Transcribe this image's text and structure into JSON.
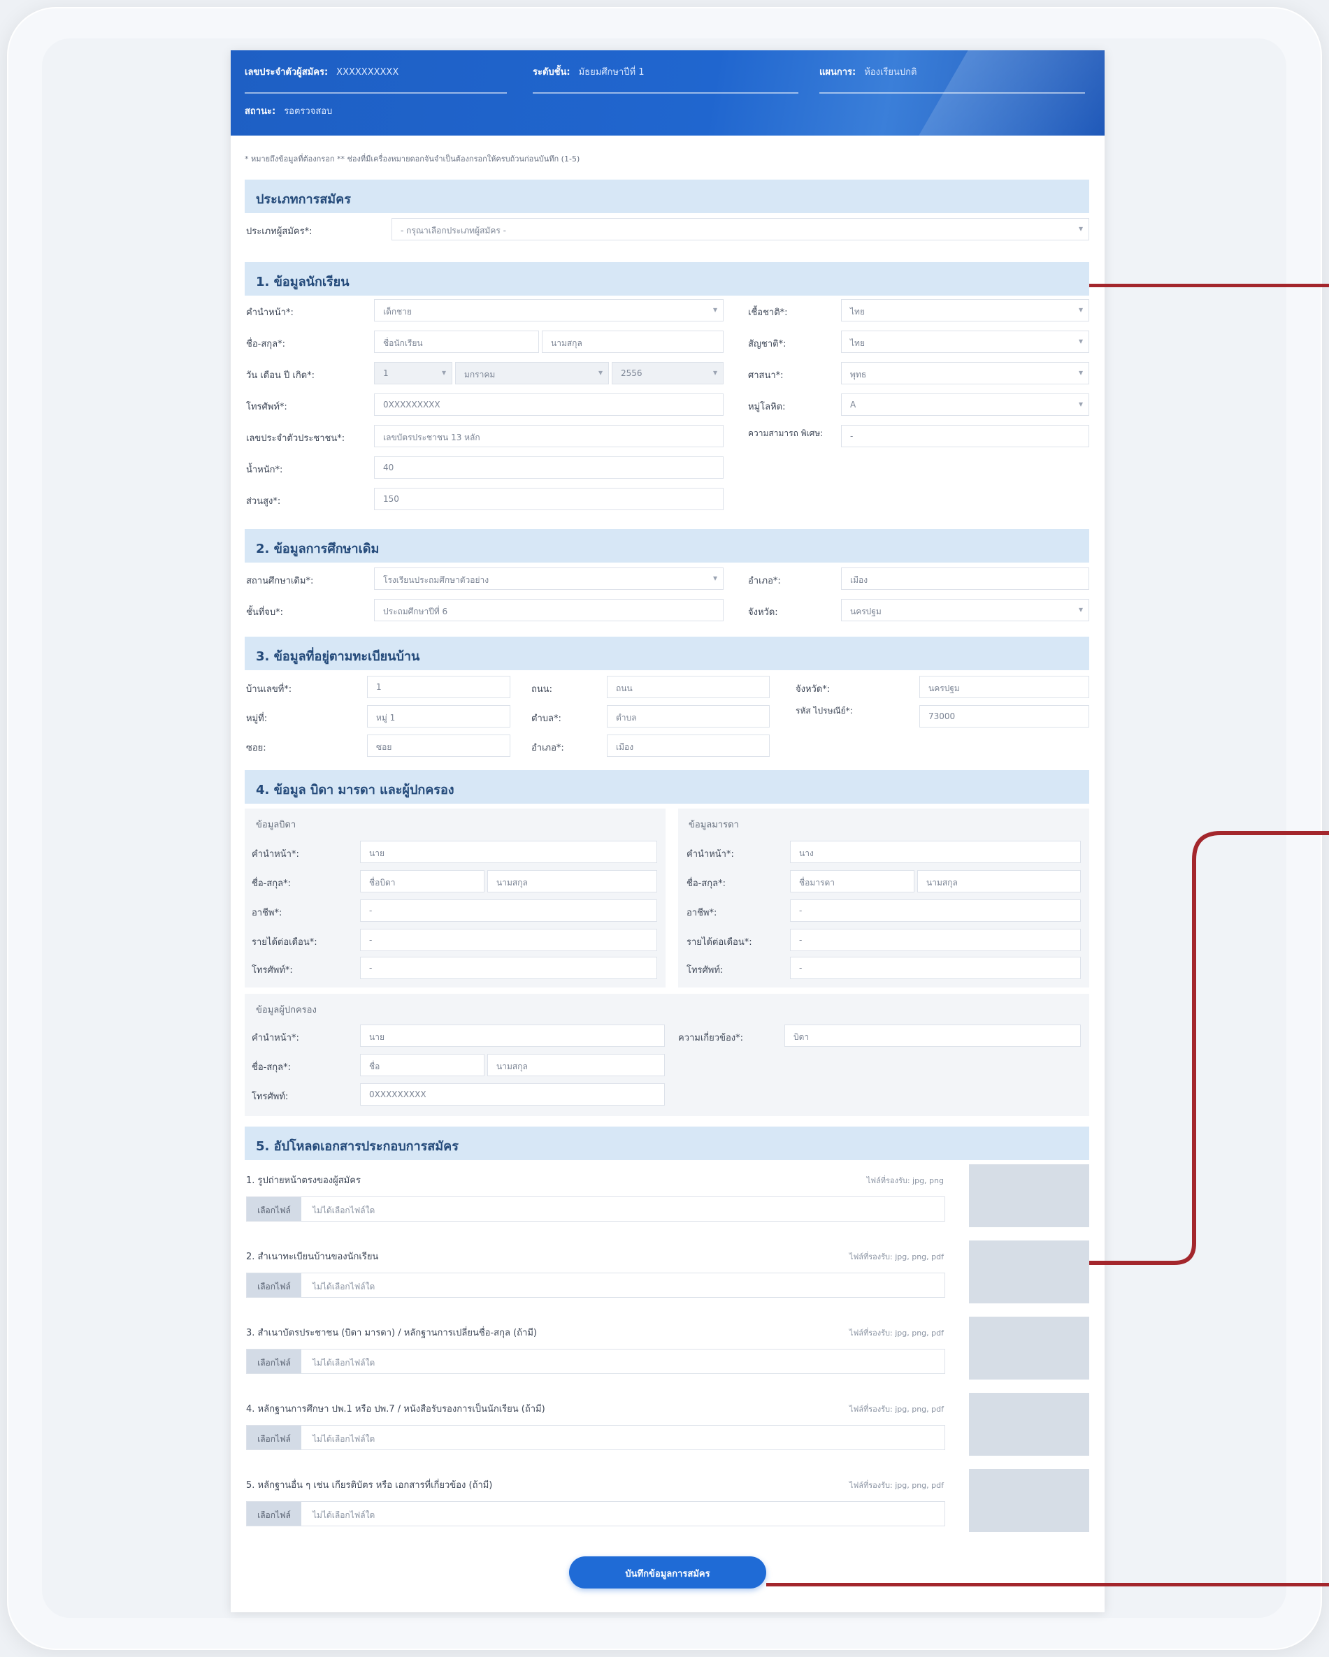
{
  "header": {
    "app_no_label": "เลขประจำตัวผู้สมัคร:",
    "app_no_value": "XXXXXXXXXX",
    "level_label": "ระดับชั้น:",
    "level_value": "มัธยมศึกษาปีที่ 1",
    "program_label": "แผนการ:",
    "program_value": "ห้องเรียนปกติ",
    "status_label": "สถานะ:",
    "status_value": "รอตรวจสอบ"
  },
  "note": "* หมายถึงข้อมูลที่ต้องกรอก  ** ช่องที่มีเครื่องหมายดอกจันจำเป็นต้องกรอกให้ครบถ้วนก่อนบันทึก (1-5)",
  "sec0": {
    "title": "ประเภทการสมัคร",
    "field_label": "ประเภทผู้สมัคร*:",
    "field_value": "- กรุณาเลือกประเภทผู้สมัคร -"
  },
  "sec1": {
    "title": "1. ข้อมูลนักเรียน",
    "left": [
      {
        "label": "คำนำหน้า*:",
        "value": "เด็กชาย",
        "select": true
      },
      {
        "label": "ชื่อ-สกุล*:",
        "value": "ชื่อนักเรียน",
        "value2": "นามสกุล"
      },
      {
        "label": "วัน เดือน ปี เกิด*:",
        "value": "1",
        "value2": "มกราคม",
        "value3": "2556"
      },
      {
        "label": "โทรศัพท์*:",
        "value": "0XXXXXXXXX"
      },
      {
        "label": "เลขประจำตัวประชาชน*:",
        "value": "เลขบัตรประชาชน 13 หลัก"
      },
      {
        "label": "น้ำหนัก*:",
        "value": "40"
      },
      {
        "label": "ส่วนสูง*:",
        "value": "150"
      }
    ],
    "right": [
      {
        "label": "เชื้อชาติ*:",
        "value": "ไทย",
        "select": true
      },
      {
        "label": "สัญชาติ*:",
        "value": "ไทย",
        "select": true
      },
      {
        "label": "ศาสนา*:",
        "value": "พุทธ",
        "select": true
      },
      {
        "label": "หมู่โลหิต:",
        "value": "A",
        "select": true
      },
      {
        "label": "ความสามารถ พิเศษ:",
        "value": "-"
      }
    ]
  },
  "sec2": {
    "title": "2. ข้อมูลการศึกษาเดิม",
    "left": [
      {
        "label": "สถานศึกษาเดิม*:",
        "value": "โรงเรียนประถมศึกษาตัวอย่าง",
        "select": true
      },
      {
        "label": "ชั้นที่จบ*:",
        "value": "ประถมศึกษาปีที่ 6"
      }
    ],
    "right": [
      {
        "label": "อำเภอ*:",
        "value": "เมือง"
      },
      {
        "label": "จังหวัด:",
        "value": "นครปฐม",
        "select": true
      }
    ]
  },
  "sec3": {
    "title": "3. ข้อมูลที่อยู่ตามทะเบียนบ้าน",
    "cells": [
      {
        "label": "บ้านเลขที่*:",
        "value": "1"
      },
      {
        "label": "ถนน:",
        "value": "ถนน"
      },
      {
        "label": "จังหวัด*:",
        "value": "นครปฐม"
      },
      {
        "label": "หมู่ที่:",
        "value": "หมู่ 1"
      },
      {
        "label": "ตำบล*:",
        "value": "ตำบล"
      },
      {
        "label": "รหัส ไปรษณีย์*:",
        "value": "73000"
      },
      {
        "label": "ซอย:",
        "value": "ซอย"
      },
      {
        "label": "อำเภอ*:",
        "value": "เมือง"
      }
    ]
  },
  "sec4": {
    "title": "4. ข้อมูล บิดา มารดา และผู้ปกครอง",
    "father": {
      "title": "ข้อมูลบิดา",
      "rows": [
        {
          "label": "คำนำหน้า*:",
          "value": "นาย"
        },
        {
          "label": "ชื่อ-สกุล*:",
          "value": "ชื่อบิดา",
          "value2": "นามสกุล"
        },
        {
          "label": "อาชีพ*:",
          "value": "-"
        },
        {
          "label": "รายได้ต่อเดือน*:",
          "value": "-"
        },
        {
          "label": "โทรศัพท์*:",
          "value": "-"
        }
      ]
    },
    "mother": {
      "title": "ข้อมูลมารดา",
      "rows": [
        {
          "label": "คำนำหน้า*:",
          "value": "นาง"
        },
        {
          "label": "ชื่อ-สกุล*:",
          "value": "ชื่อมารดา",
          "value2": "นามสกุล"
        },
        {
          "label": "อาชีพ*:",
          "value": "-"
        },
        {
          "label": "รายได้ต่อเดือน*:",
          "value": "-"
        },
        {
          "label": "โทรศัพท์:",
          "value": "-"
        }
      ]
    },
    "guardian": {
      "title": "ข้อมูลผู้ปกครอง",
      "rows": [
        {
          "label": "คำนำหน้า*:",
          "value": "นาย"
        },
        {
          "label": "ชื่อ-สกุล*:",
          "value": "ชื่อ",
          "value2": "นามสกุล"
        },
        {
          "label": "โทรศัพท์:",
          "value": "0XXXXXXXXX"
        }
      ],
      "relation_label": "ความเกี่ยวข้อง*:",
      "relation_value": "บิดา"
    }
  },
  "sec5": {
    "title": "5. อัปโหลดเอกสารประกอบการสมัคร",
    "uploads": [
      {
        "label": "1. รูปถ่ายหน้าตรงของผู้สมัคร",
        "hint": "ไฟล์ที่รองรับ: jpg, png",
        "button": "เลือกไฟล์",
        "file": "ไม่ได้เลือกไฟล์ใด"
      },
      {
        "label": "2. สำเนาทะเบียนบ้านของนักเรียน",
        "hint": "ไฟล์ที่รองรับ: jpg, png, pdf",
        "button": "เลือกไฟล์",
        "file": "ไม่ได้เลือกไฟล์ใด"
      },
      {
        "label": "3. สำเนาบัตรประชาชน (บิดา มารดา) / หลักฐานการเปลี่ยนชื่อ-สกุล (ถ้ามี)",
        "hint": "ไฟล์ที่รองรับ: jpg, png, pdf",
        "button": "เลือกไฟล์",
        "file": "ไม่ได้เลือกไฟล์ใด"
      },
      {
        "label": "4. หลักฐานการศึกษา ปพ.1 หรือ ปพ.7 / หนังสือรับรองการเป็นนักเรียน (ถ้ามี)",
        "hint": "ไฟล์ที่รองรับ: jpg, png, pdf",
        "button": "เลือกไฟล์",
        "file": "ไม่ได้เลือกไฟล์ใด"
      },
      {
        "label": "5. หลักฐานอื่น ๆ เช่น เกียรติบัตร หรือ เอกสารที่เกี่ยวข้อง (ถ้ามี)",
        "hint": "ไฟล์ที่รองรับ: jpg, png, pdf",
        "button": "เลือกไฟล์",
        "file": "ไม่ได้เลือกไฟล์ใด"
      }
    ]
  },
  "submit": {
    "label": "บันทึกข้อมูลการสมัคร"
  },
  "colors": {
    "header": "#1e5fc4",
    "section": "#d7e7f6",
    "button": "#1f6bd6",
    "callout": "#a3262c"
  }
}
